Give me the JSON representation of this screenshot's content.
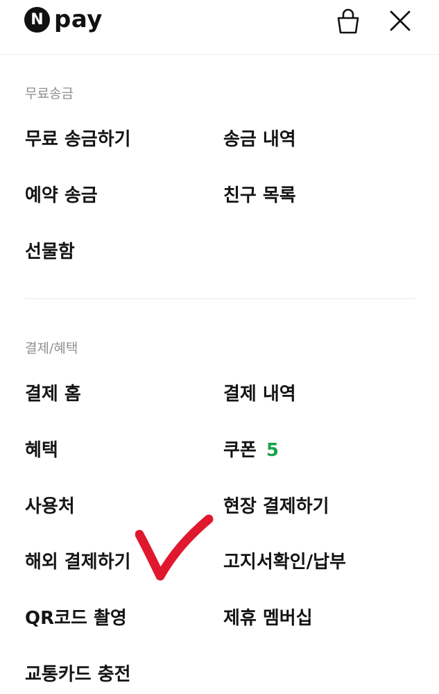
{
  "header": {
    "logo_badge": "N",
    "logo_text": "pay",
    "icons": [
      "shopping-bag-icon",
      "close-icon"
    ]
  },
  "sections": [
    {
      "title": "무료송금",
      "items": [
        "무료 송금하기",
        "송금 내역",
        "예약 송금",
        "친구 목록",
        "선물함"
      ]
    },
    {
      "title": "결제/혜택",
      "items": [
        "결제 홈",
        "결제 내역",
        "혜택",
        "쿠폰",
        "사용처",
        "현장 결제하기",
        "해외 결제하기",
        "고지서확인/납부",
        "QR코드 촬영",
        "제휴 멤버십",
        "교통카드 충전"
      ],
      "coupon_count": "5"
    }
  ],
  "colors": {
    "badge_green": "#1aa14a",
    "annotation_red": "#e0182e"
  },
  "annotation": "red-checkmark"
}
